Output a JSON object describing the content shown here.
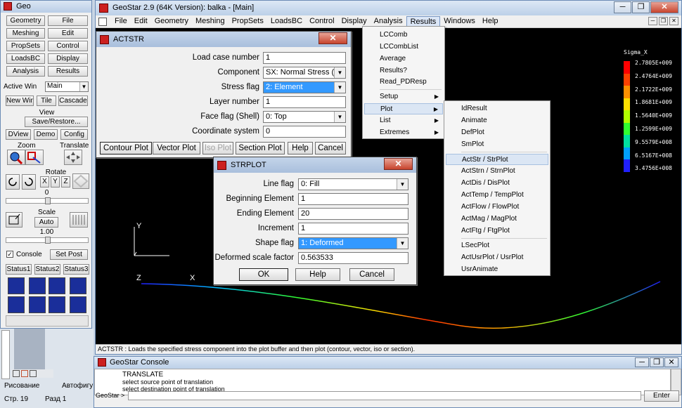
{
  "toolbox": {
    "title": "Geo",
    "buttons": [
      "Geometry",
      "File",
      "Meshing",
      "Edit",
      "PropSets",
      "Control",
      "LoadsBC",
      "Display",
      "Analysis",
      "Results"
    ],
    "active_win_label": "Active Win",
    "active_win_value": "Main",
    "row2": [
      "New Win",
      "Tile",
      "Cascade"
    ],
    "view_label": "View",
    "save_restore": "Save/Restore...",
    "row3": [
      "DView",
      "Demo",
      "Config"
    ],
    "zoom_label": "Zoom",
    "translate_label": "Translate",
    "rotate_label": "Rotate",
    "axes": [
      "X",
      "Y",
      "Z"
    ],
    "rotate_value": "0",
    "scale_label": "Scale",
    "scale_auto": "Auto",
    "scale_value": "1.00",
    "console_label": "Console",
    "set_post": "Set Post",
    "status_tabs": [
      "Status1",
      "Status2",
      "Status3"
    ]
  },
  "main": {
    "title": "GeoStar 2.9 (64K Version): balka - [Main]",
    "menu": [
      "File",
      "Edit",
      "Geometry",
      "Meshing",
      "PropSets",
      "LoadsBC",
      "Control",
      "Display",
      "Analysis",
      "Results",
      "Windows",
      "Help"
    ],
    "active_menu": "Results",
    "status": "ACTSTR : Loads the specified stress component into the plot buffer and then plot (contour, vector, iso or section).",
    "axis_y": "Y",
    "axis_z": "Z",
    "axis_x": "X",
    "legend": {
      "title": "Sigma_X",
      "values": [
        "2.7805E+009",
        "2.4764E+009",
        "2.1722E+009",
        "1.8681E+009",
        "1.5640E+009",
        "1.2599E+009",
        "9.5579E+008",
        "6.5167E+008",
        "3.4756E+008"
      ],
      "colors": [
        "#ff0000",
        "#ff4000",
        "#ff9000",
        "#ffe000",
        "#b0ff00",
        "#30ff30",
        "#00e0a0",
        "#00a0ff",
        "#2020ff"
      ]
    }
  },
  "actstr": {
    "title": "ACTSTR",
    "fields": [
      {
        "label": "Load case number",
        "value": "1",
        "type": "input"
      },
      {
        "label": "Component",
        "value": "SX: Normal Stress (X dir)",
        "type": "select"
      },
      {
        "label": "Stress flag",
        "value": "2: Element",
        "type": "select-sel"
      },
      {
        "label": "Layer number",
        "value": "1",
        "type": "input"
      },
      {
        "label": "Face flag (Shell)",
        "value": "0: Top",
        "type": "select"
      },
      {
        "label": "Coordinate system",
        "value": "0",
        "type": "input"
      }
    ],
    "buttons": [
      "Contour Plot",
      "Vector Plot",
      "Iso Plot",
      "Section Plot",
      "Help",
      "Cancel"
    ]
  },
  "strplot": {
    "title": "STRPLOT",
    "fields": [
      {
        "label": "Line flag",
        "value": "0: Fill",
        "type": "select"
      },
      {
        "label": "Beginning Element",
        "value": "1",
        "type": "input"
      },
      {
        "label": "Ending Element",
        "value": "20",
        "type": "input"
      },
      {
        "label": "Increment",
        "value": "1",
        "type": "input"
      },
      {
        "label": "Shape flag",
        "value": "1: Deformed",
        "type": "select-sel"
      },
      {
        "label": "Deformed scale factor",
        "value": "0.563533",
        "type": "input"
      }
    ],
    "buttons": [
      "OK",
      "Help",
      "Cancel"
    ]
  },
  "results_menu": {
    "items": [
      "LCComb",
      "LCCombList",
      "Average",
      "Results?",
      "Read_PDResp",
      "Setup",
      "Plot",
      "List",
      "Extremes"
    ],
    "submenu_items": [
      "Setup",
      "Plot",
      "List",
      "Extremes"
    ],
    "highlight": "Plot"
  },
  "plot_menu": {
    "items": [
      "IdResult",
      "Animate",
      "DefPlot",
      "SmPlot",
      "ActStr / StrPlot",
      "ActStrn / StrnPlot",
      "ActDis / DisPlot",
      "ActTemp / TempPlot",
      "ActFlow / FlowPlot",
      "ActMag / MagPlot",
      "ActFtg / FtgPlot",
      "LSecPlot",
      "ActUsrPlot / UsrPlot",
      "UsrAnimate"
    ],
    "highlight": "ActStr / StrPlot"
  },
  "console": {
    "title": "GeoStar Console",
    "lines": [
      "TRANSLATE",
      "select source point of translation",
      "select destination point of translation"
    ],
    "prompt": "GeoStar >",
    "enter": "Enter"
  },
  "word": {
    "drawing": "Рисование",
    "autoshapes": "Автофигу",
    "page": "Стр. 19",
    "section": "Разд 1"
  }
}
